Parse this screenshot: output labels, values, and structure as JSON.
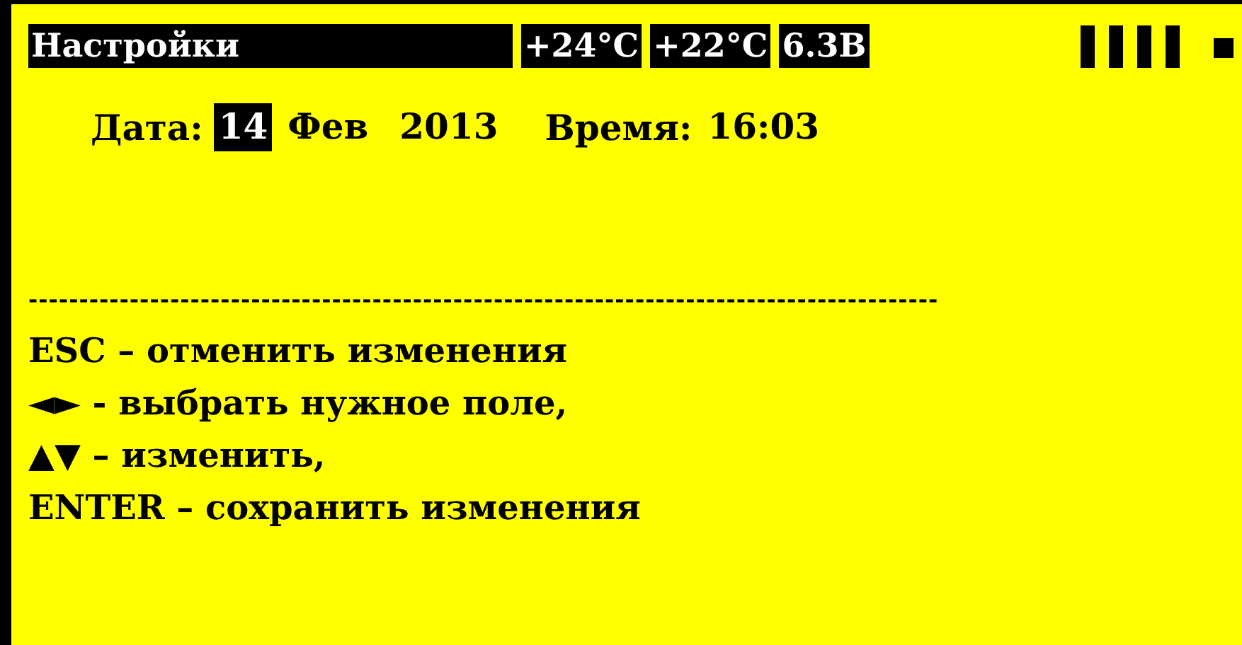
{
  "header": {
    "title": "Настройки",
    "readings": [
      "+24°C",
      "+22°C",
      "6.3В"
    ]
  },
  "date_line": {
    "date_label": "Дата:",
    "fields": [
      {
        "kind": "day",
        "value": "14",
        "selected": true
      },
      {
        "kind": "month",
        "value": "Фев",
        "selected": false
      },
      {
        "kind": "year",
        "value": "2013",
        "selected": false
      }
    ],
    "time_label": "Время:",
    "time": {
      "value": "16:03",
      "selected": false
    }
  },
  "separator": "------------------------------------------------------------------------------------------",
  "help": [
    "ESC – отменить изменения",
    "◄► - выбрать нужное поле,",
    "▲▼ – изменить,",
    "ENTER – сохранить изменения"
  ]
}
